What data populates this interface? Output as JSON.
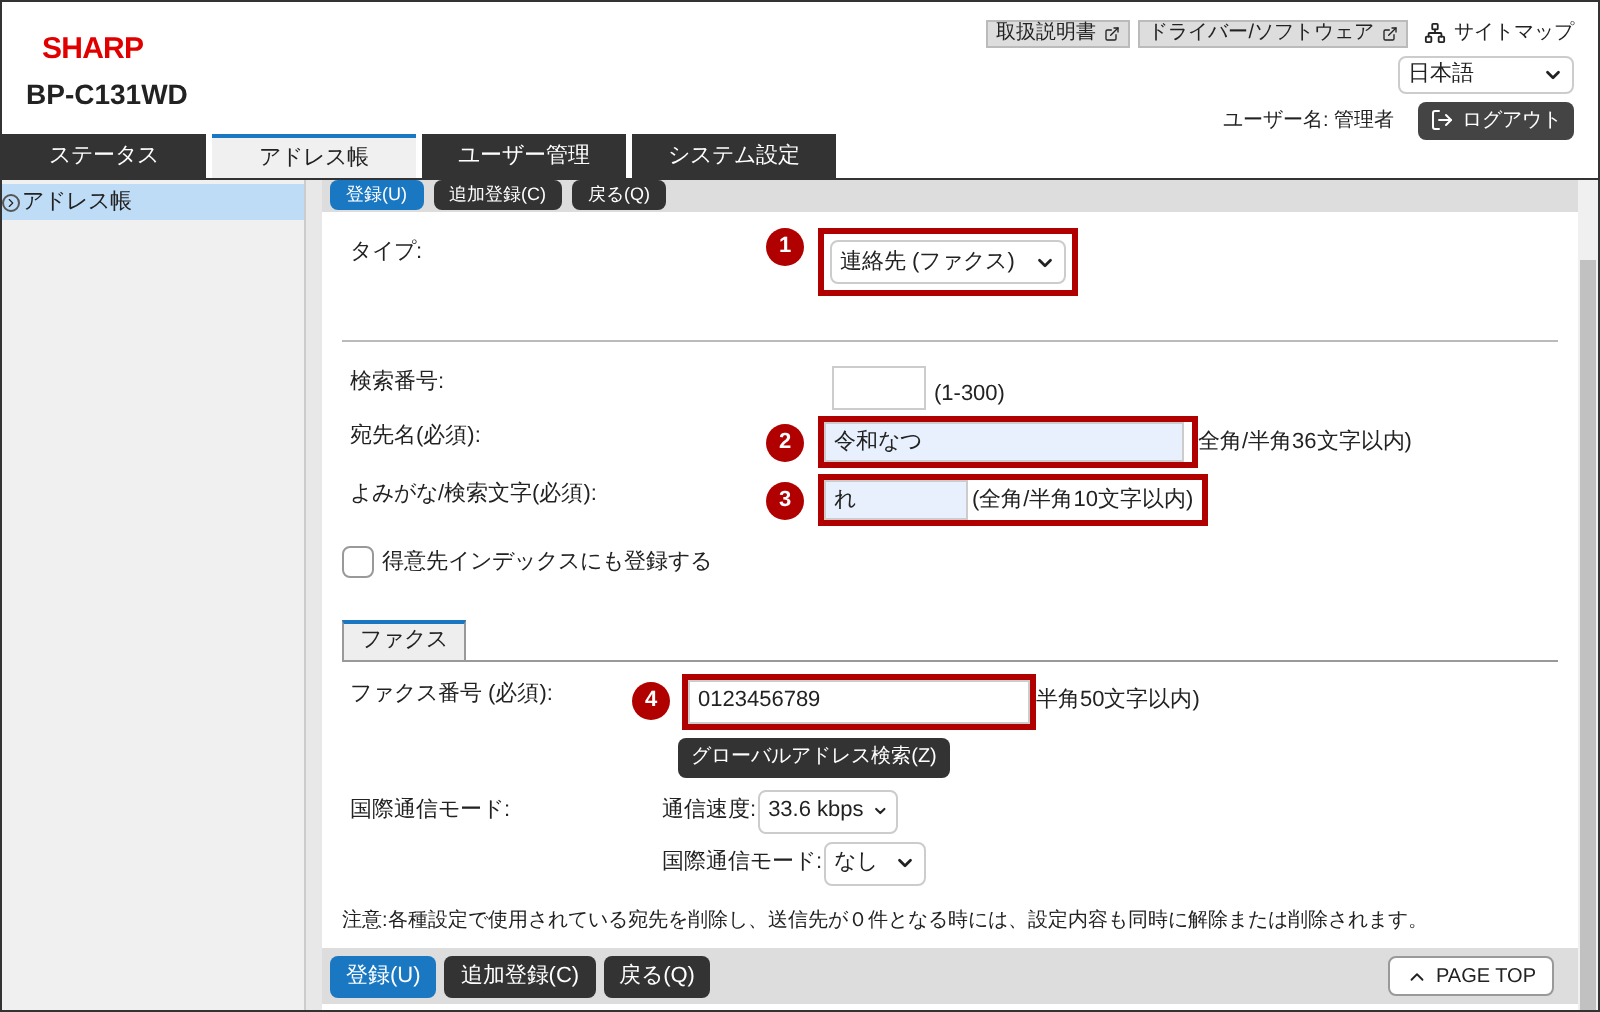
{
  "header": {
    "logo": "SHARP",
    "model": "BP-C131WD",
    "links": [
      {
        "label": "取扱説明書"
      },
      {
        "label": "ドライバー/ソフトウェア"
      }
    ],
    "sitemap": "サイトマップ",
    "language": "日本語",
    "user": "ユーザー名: 管理者",
    "logout": "ログアウト"
  },
  "tabs": [
    {
      "label": "ステータス",
      "selected": false
    },
    {
      "label": "アドレス帳",
      "selected": true
    },
    {
      "label": "ユーザー管理",
      "selected": false
    },
    {
      "label": "システム設定",
      "selected": false
    }
  ],
  "sidebar": {
    "items": [
      {
        "label": "アドレス帳",
        "selected": true
      }
    ]
  },
  "top_buttons": [
    {
      "label": "登録(U)",
      "kind": "primary"
    },
    {
      "label": "追加登録(C)",
      "kind": "secondary"
    },
    {
      "label": "戻る(Q)",
      "kind": "secondary"
    }
  ],
  "type_row": {
    "label": "タイプ:",
    "callout": "1",
    "value": "連絡先 (ファクス)"
  },
  "search_number": {
    "label": "検索番号:",
    "hint": "(1-300)"
  },
  "name": {
    "label": "宛先名(必須):",
    "callout": "2",
    "value": "令和なつ",
    "hint": "全角/半角36文字以内)"
  },
  "reading": {
    "label": "よみがな/検索文字(必須):",
    "callout": "3",
    "value": "れ",
    "hint": "(全角/半角10文字以内)"
  },
  "favorite": {
    "label": "得意先インデックスにも登録する",
    "checked": false
  },
  "fax_tab": {
    "label": "ファクス",
    "selected": true
  },
  "fax_number": {
    "label": "ファクス番号 (必須):",
    "callout": "4",
    "value": "0123456789",
    "hint": "半角50文字以内)"
  },
  "global_search": "グローバルアドレス検索(Z)",
  "intl_mode": {
    "label": "国際通信モード:",
    "speed_label": "通信速度:",
    "speed": "33.6 kbps",
    "mode_label": "国際通信モード:",
    "mode": "なし"
  },
  "note": "注意:各種設定で使用されている宛先を削除し、送信先が０件となる時には、設定内容も同時に解除または削除されます。",
  "bottom_buttons": [
    {
      "label": "登録(U)",
      "kind": "primary"
    },
    {
      "label": "追加登録(C)",
      "kind": "secondary"
    },
    {
      "label": "戻る(Q)",
      "kind": "secondary"
    }
  ],
  "page_top": "PAGE TOP"
}
